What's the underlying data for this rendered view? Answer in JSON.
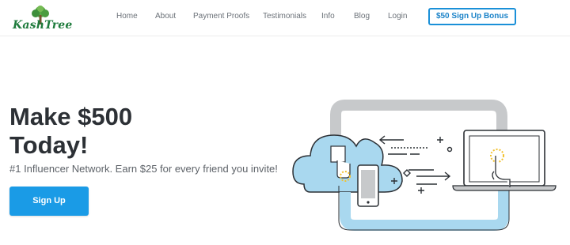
{
  "brand": {
    "name": "KashTree"
  },
  "nav": {
    "items": [
      {
        "label": "Home"
      },
      {
        "label": "About"
      },
      {
        "label": "Payment Proofs"
      },
      {
        "label": "Testimonials"
      },
      {
        "label": "Info"
      },
      {
        "label": "Blog"
      },
      {
        "label": "Login"
      }
    ],
    "cta_label": "$50 Sign Up Bonus"
  },
  "hero": {
    "title_line1": "Make $500",
    "title_line2": "Today!",
    "subtitle": "#1 Influencer Network. Earn $25 for every friend you invite!",
    "button_label": "Sign Up"
  },
  "colors": {
    "accent": "#1a9be6",
    "brand_green": "#1e7b3c",
    "cloud_blue": "#a9d8ef",
    "pipe_gray": "#c7c9cb"
  },
  "illustration": {
    "icons": [
      "cloud-icon",
      "smartphone-icon",
      "laptop-icon",
      "tap-hand-icon",
      "arrow-left-icon",
      "arrow-right-icon",
      "plus-icon"
    ]
  }
}
